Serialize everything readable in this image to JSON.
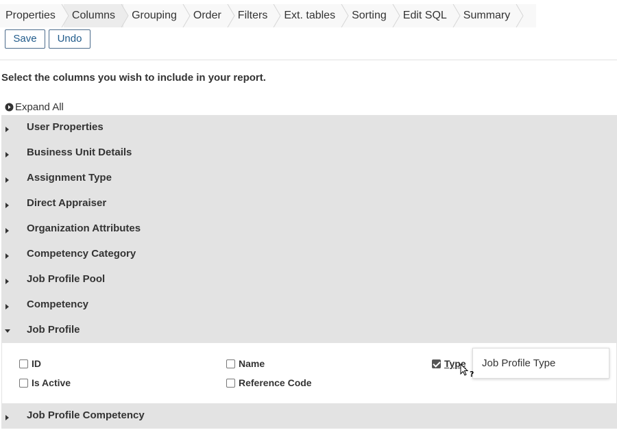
{
  "tabs": [
    {
      "label": "Properties",
      "active": false
    },
    {
      "label": "Columns",
      "active": true
    },
    {
      "label": "Grouping",
      "active": false
    },
    {
      "label": "Order",
      "active": false
    },
    {
      "label": "Filters",
      "active": false
    },
    {
      "label": "Ext. tables",
      "active": false
    },
    {
      "label": "Sorting",
      "active": false
    },
    {
      "label": "Edit SQL",
      "active": false
    },
    {
      "label": "Summary",
      "active": false
    }
  ],
  "toolbar": {
    "save_label": "Save",
    "undo_label": "Undo"
  },
  "instruction": "Select the columns you wish to include in your report.",
  "expand_all_label": "Expand All",
  "sections": [
    {
      "title": "User Properties",
      "expanded": false
    },
    {
      "title": "Business Unit Details",
      "expanded": false
    },
    {
      "title": "Assignment Type",
      "expanded": false
    },
    {
      "title": "Direct Appraiser",
      "expanded": false
    },
    {
      "title": "Organization Attributes",
      "expanded": false
    },
    {
      "title": "Competency Category",
      "expanded": false
    },
    {
      "title": "Job Profile Pool",
      "expanded": false
    },
    {
      "title": "Competency",
      "expanded": false
    },
    {
      "title": "Job Profile",
      "expanded": true
    },
    {
      "title": "Job Profile Competency",
      "expanded": false
    }
  ],
  "job_profile_options": [
    {
      "label": "ID",
      "checked": false
    },
    {
      "label": "Name",
      "checked": false
    },
    {
      "label": "Type",
      "checked": true
    },
    {
      "label": "Is Active",
      "checked": false
    },
    {
      "label": "Reference Code",
      "checked": false
    }
  ],
  "tooltip_text": "Job Profile Type",
  "colors": {
    "tab_bg": "#f8f8f8",
    "tab_active_bg": "#ececec",
    "section_bg": "#e3e3e3",
    "button_text": "#1f5a8a",
    "button_border": "#4a6a8a"
  }
}
